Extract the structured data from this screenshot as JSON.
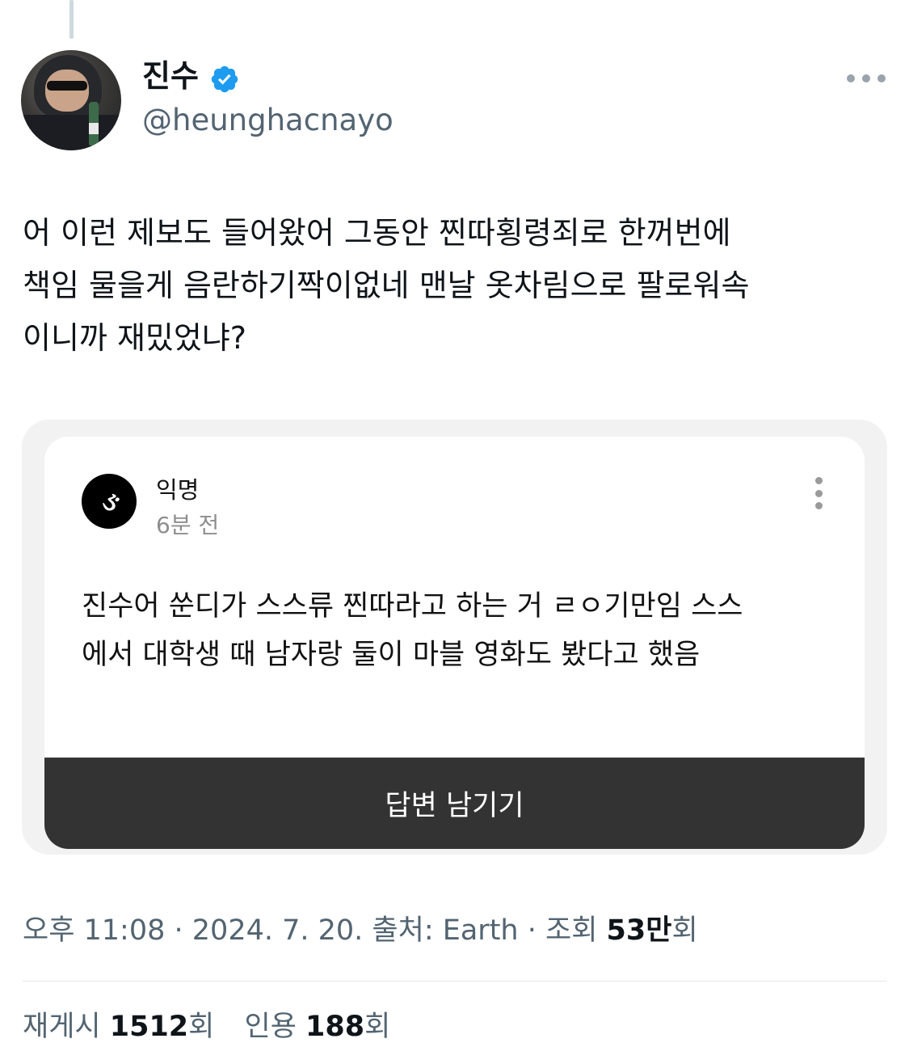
{
  "author": {
    "display_name": "진수",
    "handle": "@heunghacnayo"
  },
  "tweet": {
    "text": "어 이런 제보도 들어왔어 그동안 찐따횡령죄로 한꺼번에\n책임 물을게 음란하기짝이없네 맨날 옷차림으로 팔로워속\n이니까 재밌었냐?"
  },
  "embed": {
    "name": "익명",
    "time": "6분 전",
    "body": "진수어 쑨디가 스스류 찐따라고 하는 거 ㄹㅇ기만임 스스\n에서 대학생 때 남자랑 둘이 마블 영화도 봤다고 했음",
    "answer_button": "답변 남기기"
  },
  "meta": {
    "time": "오후 11:08",
    "sep1": " · ",
    "date": "2024. 7. 20.",
    "source_label": " 출처: ",
    "source": "Earth",
    "sep2": " · ",
    "views_label": "조회 ",
    "views_value": "53만",
    "views_unit": "회"
  },
  "stats": {
    "retweets_label": "재게시 ",
    "retweets_value": "1512",
    "retweets_unit": "회",
    "quotes_label": "인용 ",
    "quotes_value": "188",
    "quotes_unit": "회"
  },
  "colors": {
    "verified": "#1d9bf0",
    "secondary_text": "#536471",
    "answer_button_bg": "#333333"
  }
}
